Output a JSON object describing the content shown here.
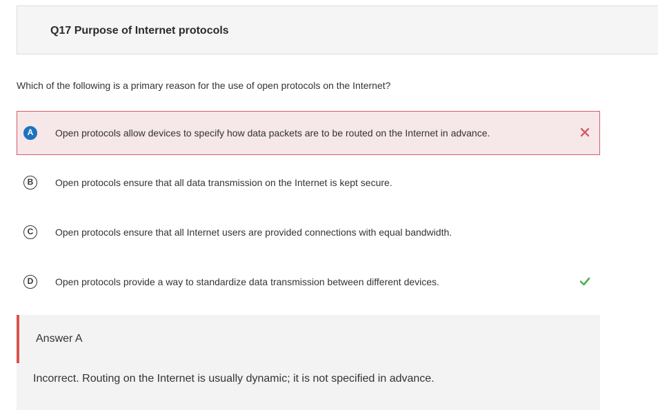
{
  "header": {
    "title": "Q17 Purpose of Internet protocols"
  },
  "question": {
    "text": "Which of the following is a primary reason for the use of open protocols on the Internet?"
  },
  "options": [
    {
      "letter": "A",
      "text": "Open protocols allow devices to specify how data packets are to be routed on the Internet in advance.",
      "state": "selected-incorrect",
      "mark_icon": "x-icon"
    },
    {
      "letter": "B",
      "text": "Open protocols ensure that all data transmission on the Internet is kept secure.",
      "state": "unselected"
    },
    {
      "letter": "C",
      "text": "Open protocols ensure that all Internet users are provided connections with equal bandwidth.",
      "state": "unselected"
    },
    {
      "letter": "D",
      "text": "Open protocols provide a way to standardize data transmission between different devices.",
      "state": "correct",
      "mark_icon": "check-icon"
    }
  ],
  "feedback": {
    "answer_label": "Answer A",
    "explanation": "Incorrect. Routing on the Internet is usually dynamic; it is not specified in advance."
  },
  "colors": {
    "selected_letter": "#1e73be",
    "incorrect": "#d65a68",
    "incorrect_bg": "#f6e7e8",
    "correct": "#4caf50",
    "feedback_bar": "#d9534f"
  }
}
